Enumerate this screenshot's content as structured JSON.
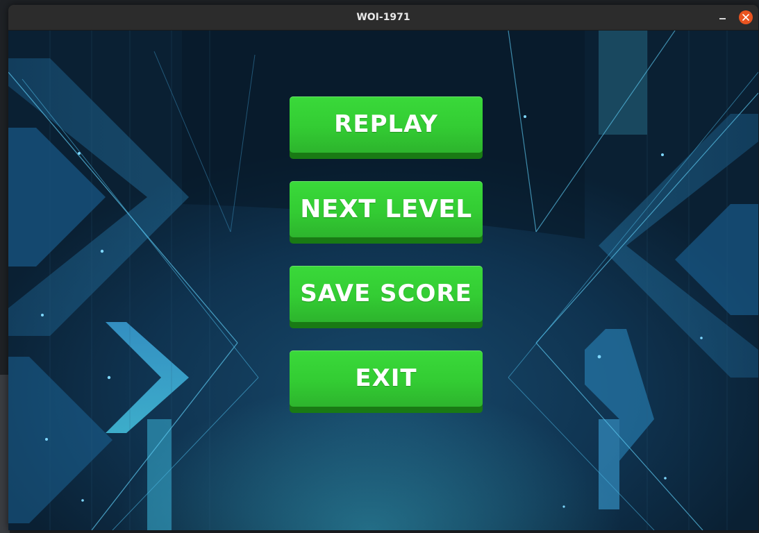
{
  "window": {
    "title": "WOI-1971"
  },
  "icons": {
    "minimize": "minimize-icon",
    "close": "close-icon"
  },
  "colors": {
    "button_green": "#33cc33",
    "button_shadow": "#197a14",
    "close_orange": "#e95420",
    "background_blue": "#0f3350"
  },
  "menu": {
    "buttons": [
      {
        "id": "replay",
        "label": "REPLAY"
      },
      {
        "id": "next_level",
        "label": "NEXT LEVEL"
      },
      {
        "id": "save_score",
        "label": "SAVE SCORE"
      },
      {
        "id": "exit",
        "label": "EXIT"
      }
    ]
  }
}
